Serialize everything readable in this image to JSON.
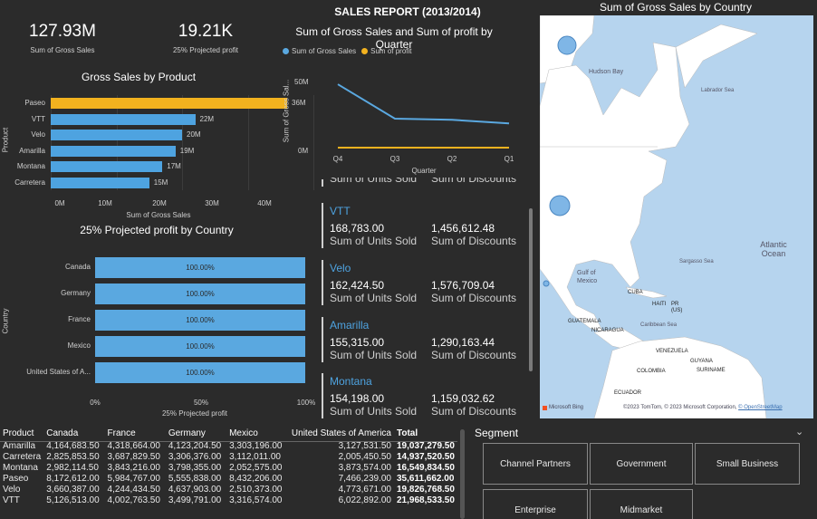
{
  "header": {
    "title": "SALES REPORT (2013/2014)"
  },
  "kpis": [
    {
      "value": "127.93M",
      "label": "Sum of Gross Sales"
    },
    {
      "value": "19.21K",
      "label": "25% Projected profit"
    }
  ],
  "gross_by_product": {
    "title": "Gross Sales by Product",
    "ylabel": "Product",
    "xlabel": "Sum of Gross Sales",
    "ticks": [
      "0M",
      "10M",
      "20M",
      "30M",
      "40M"
    ]
  },
  "projected_by_country": {
    "title": "25% Projected profit by Country",
    "ylabel": "Country",
    "xlabel": "25% Projected profit",
    "ticks": [
      "0%",
      "50%",
      "100%"
    ]
  },
  "quarter_chart": {
    "title": "Sum of Gross Sales and Sum of profit by Quarter",
    "legend": [
      "Sum of Gross Sales",
      "Sum of profit"
    ],
    "ylabel": "Sum of Gross Sal...",
    "xlabel": "Quarter",
    "yticks": [
      "50M",
      "0M"
    ]
  },
  "cards": {
    "partial_labels": [
      "Sum of Units Sold",
      "Sum of Discounts"
    ],
    "items": [
      {
        "product": "VTT",
        "units": "168,783.00",
        "units_label": "Sum of Units Sold",
        "disc": "1,456,612.48",
        "disc_label": "Sum of Discounts"
      },
      {
        "product": "Velo",
        "units": "162,424.50",
        "units_label": "Sum of Units Sold",
        "disc": "1,576,709.04",
        "disc_label": "Sum of Discounts"
      },
      {
        "product": "Amarilla",
        "units": "155,315.00",
        "units_label": "Sum of Units Sold",
        "disc": "1,290,163.44",
        "disc_label": "Sum of Discounts"
      },
      {
        "product": "Montana",
        "units": "154,198.00",
        "units_label": "Sum of Units Sold",
        "disc": "1,159,032.62",
        "disc_label": "Sum of Discounts"
      }
    ]
  },
  "map": {
    "title": "Sum of Gross Sales by Country",
    "labels": [
      "Hudson Bay",
      "Labrador Sea",
      "Atlantic Ocean",
      "Sargasso Sea",
      "Gulf of Mexico",
      "CUBA",
      "HAITI",
      "PR (US)",
      "GUATEMALA",
      "NICARAGUA",
      "Caribbean Sea",
      "VENEZUELA",
      "GUYANA",
      "SURINAME",
      "COLOMBIA",
      "ECUADOR"
    ],
    "footer_left": "Microsoft Bing",
    "footer_right": "©2023 TomTom, © 2023 Microsoft Corporation,",
    "footer_link": "© OpenStreetMap",
    "colors": {
      "water": "#b6d4ee",
      "land": "#ffffff",
      "bubble": "#4ea3e0"
    }
  },
  "table": {
    "headers": [
      "Product",
      "Canada",
      "France",
      "Germany",
      "Mexico",
      "United States of America",
      "Total"
    ],
    "rows": [
      [
        "Amarilla",
        "4,164,683.50",
        "4,318,664.00",
        "4,123,204.50",
        "3,303,196.00",
        "3,127,531.50",
        "19,037,279.50"
      ],
      [
        "Carretera",
        "2,825,853.50",
        "3,687,829.50",
        "3,306,376.00",
        "3,112,011.00",
        "2,005,450.50",
        "14,937,520.50"
      ],
      [
        "Montana",
        "2,982,114.50",
        "3,843,216.00",
        "3,798,355.00",
        "2,052,575.00",
        "3,873,574.00",
        "16,549,834.50"
      ],
      [
        "Paseo",
        "8,172,612.00",
        "5,984,767.00",
        "5,555,838.00",
        "8,432,206.00",
        "7,466,239.00",
        "35,611,662.00"
      ],
      [
        "Velo",
        "3,660,387.00",
        "4,244,434.50",
        "4,637,903.00",
        "2,510,373.00",
        "4,773,671.00",
        "19,826,768.50"
      ],
      [
        "VTT",
        "5,126,513.00",
        "4,002,763.50",
        "3,499,791.00",
        "3,316,574.00",
        "6,022,892.00",
        "21,968,533.50"
      ]
    ]
  },
  "segment": {
    "title": "Segment",
    "chevron": "chevron-down-icon",
    "buttons": [
      "Channel Partners",
      "Government",
      "Small Business",
      "Enterprise",
      "Midmarket"
    ]
  },
  "chart_data": [
    {
      "type": "bar",
      "title": "Gross Sales by Product",
      "xlabel": "Sum of Gross Sales",
      "ylabel": "Product",
      "categories": [
        "Paseo",
        "VTT",
        "Velo",
        "Amarilla",
        "Montana",
        "Carretera"
      ],
      "values": [
        36,
        22,
        20,
        19,
        17,
        15
      ],
      "data_labels": [
        "36M",
        "22M",
        "20M",
        "19M",
        "17M",
        "15M"
      ],
      "xlim": [
        0,
        40
      ],
      "colors": [
        "#f2b21f",
        "#4ea3e0",
        "#4ea3e0",
        "#4ea3e0",
        "#4ea3e0",
        "#4ea3e0"
      ]
    },
    {
      "type": "bar",
      "title": "25% Projected profit by Country",
      "xlabel": "25% Projected profit",
      "ylabel": "Country",
      "categories": [
        "Canada",
        "Germany",
        "France",
        "Mexico",
        "United States of A..."
      ],
      "values": [
        100,
        100,
        100,
        100,
        100
      ],
      "data_labels": [
        "100.00%",
        "100.00%",
        "100.00%",
        "100.00%",
        "100.00%"
      ],
      "xlim": [
        0,
        100
      ],
      "color": "#5aa8e0"
    },
    {
      "type": "line",
      "title": "Sum of Gross Sales and Sum of profit by Quarter",
      "xlabel": "Quarter",
      "ylabel": "Sum of Gross Sal...",
      "categories": [
        "Q4",
        "Q3",
        "Q2",
        "Q1"
      ],
      "series": [
        {
          "name": "Sum of Gross Sales",
          "values": [
            55,
            26,
            25,
            22
          ],
          "color": "#5aa8e0"
        },
        {
          "name": "Sum of profit",
          "values": [
            1.5,
            1.5,
            1.5,
            1.5
          ],
          "color": "#f2b21f"
        }
      ],
      "ylim": [
        0,
        65
      ]
    }
  ]
}
